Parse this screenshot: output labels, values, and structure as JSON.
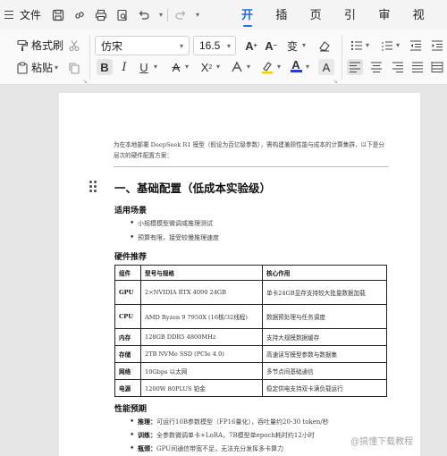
{
  "menubar": {
    "file_label": "文件",
    "tabs": [
      {
        "label": "开始",
        "active": true
      },
      {
        "label": "插入",
        "active": false
      },
      {
        "label": "页面",
        "active": false
      },
      {
        "label": "引用",
        "active": false
      },
      {
        "label": "审阅",
        "active": false
      },
      {
        "label": "视图",
        "active": false
      }
    ]
  },
  "ribbon": {
    "format_painter": "格式刷",
    "paste": "粘贴",
    "font_name": "仿宋",
    "font_size": "16.5"
  },
  "document": {
    "intro": "为在本地部署 DeepSeek R1 模型（假设为百亿级参数），需构建兼顾性能与成本的计算集群，以下是分层次的硬件配置方案：",
    "heading1": "一、基础配置（低成本实验级）",
    "scenario_title": "适用场景",
    "scenario_items": [
      "小规模模型微调或推理测试",
      "预算有限，接受较慢推理速度"
    ],
    "hardware_title": "硬件推荐",
    "table": {
      "headers": [
        "组件",
        "型号与规格",
        "核心作用"
      ],
      "rows": [
        {
          "component": "GPU",
          "spec": "2×NVIDIA RTX 4090 24GB",
          "role": "单卡24GB显存支持较大批量数据加载",
          "tall": true
        },
        {
          "component": "CPU",
          "spec": "AMD Ryzen 9 7950X (16核/32线程)",
          "role": "数据预处理与任务调度",
          "tall": true
        },
        {
          "component": "内存",
          "spec": "128GB DDR5 4800MHz",
          "role": "支持大规模数据缓存",
          "tall": false
        },
        {
          "component": "存储",
          "spec": "2TB NVMe SSD (PCIe 4.0)",
          "role": "高速读写模型参数与数据集",
          "tall": false
        },
        {
          "component": "网络",
          "spec": "10Gbps 以太网",
          "role": "多节点间基础通信",
          "tall": false
        },
        {
          "component": "电源",
          "spec": "1200W 80PLUS 铂金",
          "role": "稳定供电支持双卡满负载运行",
          "tall": false
        }
      ]
    },
    "perf_title": "性能预期",
    "perf_items": [
      {
        "key": "推理：",
        "text": "可运行10B参数模型（FP16量化），吞吐量约20-30 token/秒"
      },
      {
        "key": "训练：",
        "text": "全参数微调单卡+LoRA，7B模型单epoch耗时约12小时"
      },
      {
        "key": "瓶颈：",
        "text": "GPU间通信带宽不足，无法充分发挥多卡算力"
      }
    ]
  },
  "watermark": "@搞懂下载教程"
}
